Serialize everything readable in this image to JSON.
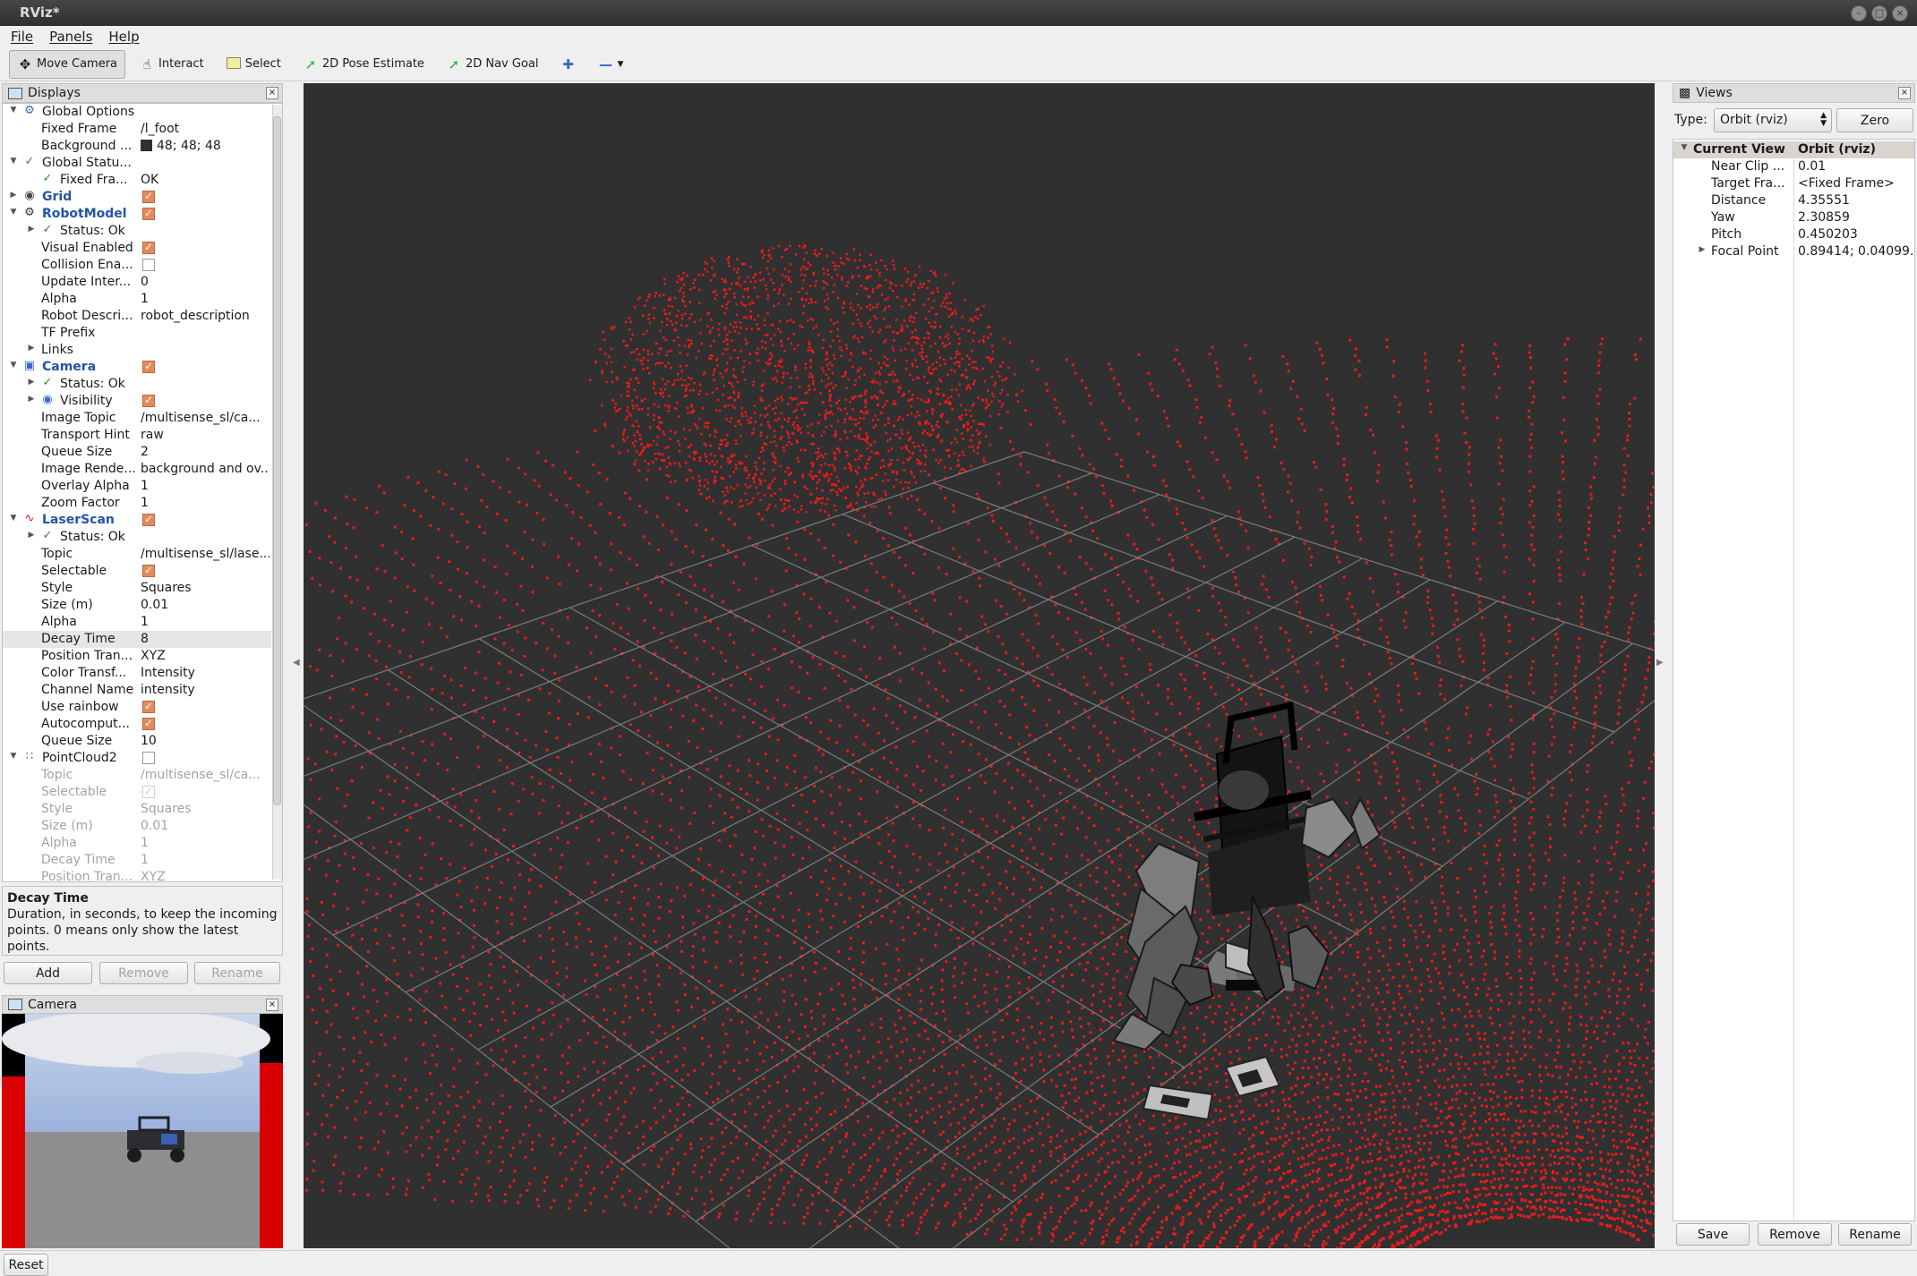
{
  "window": {
    "title": "RViz*"
  },
  "menu": [
    "File",
    "Panels",
    "Help"
  ],
  "toolbar": {
    "tools": [
      {
        "label": "Move Camera",
        "icon": "move-camera-icon",
        "active": true
      },
      {
        "label": "Interact",
        "icon": "interact-hand-icon"
      },
      {
        "label": "Select",
        "icon": "select-box-icon"
      },
      {
        "label": "2D Pose Estimate",
        "icon": "pose-estimate-arrow-icon"
      },
      {
        "label": "2D Nav Goal",
        "icon": "nav-goal-arrow-icon"
      }
    ]
  },
  "displays": {
    "title": "Displays",
    "rows": [
      {
        "name": "Global Options"
      },
      {
        "name": "Fixed Frame",
        "value": "/l_foot"
      },
      {
        "name": "Background ...",
        "value": "48; 48; 48"
      },
      {
        "name": "Global Statu..."
      },
      {
        "name": "Fixed Fra...",
        "value": "OK"
      },
      {
        "name": "Grid"
      },
      {
        "name": "RobotModel"
      },
      {
        "name": "Status: Ok"
      },
      {
        "name": "Visual Enabled"
      },
      {
        "name": "Collision Ena..."
      },
      {
        "name": "Update Inter...",
        "value": "0"
      },
      {
        "name": "Alpha",
        "value": "1"
      },
      {
        "name": "Robot Descri...",
        "value": "robot_description"
      },
      {
        "name": "TF Prefix",
        "value": ""
      },
      {
        "name": "Links"
      },
      {
        "name": "Camera"
      },
      {
        "name": "Status: Ok"
      },
      {
        "name": "Visibility"
      },
      {
        "name": "Image Topic",
        "value": "/multisense_sl/ca..."
      },
      {
        "name": "Transport Hint",
        "value": "raw"
      },
      {
        "name": "Queue Size",
        "value": "2"
      },
      {
        "name": "Image Rende...",
        "value": "background and ov..."
      },
      {
        "name": "Overlay Alpha",
        "value": "1"
      },
      {
        "name": "Zoom Factor",
        "value": "1"
      },
      {
        "name": "LaserScan"
      },
      {
        "name": "Status: Ok"
      },
      {
        "name": "Topic",
        "value": "/multisense_sl/lase..."
      },
      {
        "name": "Selectable"
      },
      {
        "name": "Style",
        "value": "Squares"
      },
      {
        "name": "Size (m)",
        "value": "0.01"
      },
      {
        "name": "Alpha",
        "value": "1"
      },
      {
        "name": "Decay Time",
        "value": "8"
      },
      {
        "name": "Position Tran...",
        "value": "XYZ"
      },
      {
        "name": "Color Transf...",
        "value": "Intensity"
      },
      {
        "name": "Channel Name",
        "value": "intensity"
      },
      {
        "name": "Use rainbow"
      },
      {
        "name": "Autocomput..."
      },
      {
        "name": "Queue Size",
        "value": "10"
      },
      {
        "name": "PointCloud2"
      },
      {
        "name": "Topic",
        "value": "/multisense_sl/ca..."
      },
      {
        "name": "Selectable"
      },
      {
        "name": "Style",
        "value": "Squares"
      },
      {
        "name": "Size (m)",
        "value": "0.01"
      },
      {
        "name": "Alpha",
        "value": "1"
      },
      {
        "name": "Decay Time",
        "value": "1"
      },
      {
        "name": "Position Tran...",
        "value": "XYZ"
      }
    ]
  },
  "help": {
    "title": "Decay Time",
    "text": "Duration, in seconds, to keep the incoming points. 0 means only show the latest points."
  },
  "buttons": {
    "add": "Add",
    "remove": "Remove",
    "rename": "Rename"
  },
  "camera_panel": {
    "title": "Camera"
  },
  "views": {
    "title": "Views",
    "type_label": "Type:",
    "type_value": "Orbit (rviz)",
    "zero": "Zero",
    "header": [
      "Current View",
      "Orbit (rviz)"
    ],
    "rows": [
      {
        "key": "Near Clip ...",
        "value": "0.01"
      },
      {
        "key": "Target Fra...",
        "value": "<Fixed Frame>"
      },
      {
        "key": "Distance",
        "value": "4.35551"
      },
      {
        "key": "Yaw",
        "value": "2.30859"
      },
      {
        "key": "Pitch",
        "value": "0.450203"
      },
      {
        "key": "Focal Point",
        "value": "0.89414; 0.04099..."
      }
    ],
    "save": "Save",
    "remove": "Remove",
    "rename": "Rename"
  },
  "status": {
    "reset": "Reset"
  },
  "colors": {
    "background": "#303030",
    "laser": "#ff1a1a",
    "accent": "#e58a5a"
  }
}
